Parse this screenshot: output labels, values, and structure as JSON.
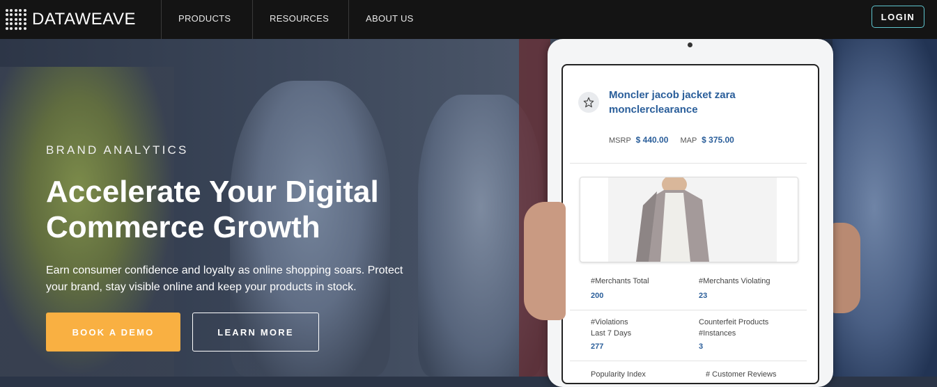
{
  "brand": {
    "name": "DATAWEAVE"
  },
  "nav": {
    "items": [
      {
        "label": "PRODUCTS"
      },
      {
        "label": "RESOURCES"
      },
      {
        "label": "ABOUT US"
      }
    ],
    "login_label": "LOGIN"
  },
  "hero": {
    "eyebrow": "BRAND ANALYTICS",
    "headline_line1": "Accelerate Your Digital",
    "headline_line2": "Commerce Growth",
    "subtext_line1": "Earn consumer confidence and loyalty as online shopping soars. Protect",
    "subtext_line2": "your brand, stay visible online and keep your products in stock.",
    "primary_cta": "BOOK A DEMO",
    "secondary_cta": "LEARN MORE"
  },
  "product_card": {
    "title_line1": "Moncler jacob jacket zara",
    "title_line2": "monclerclearance",
    "msrp_label": "MSRP",
    "msrp_value": "$ 440.00",
    "map_label": "MAP",
    "map_value": "$ 375.00",
    "stats": [
      {
        "label": "#Merchants Total",
        "value": "200"
      },
      {
        "label": "#Merchants Violating",
        "value": "23"
      },
      {
        "label_line1": "#Violations",
        "label_line2": "Last 7 Days",
        "value": "277"
      },
      {
        "label_line1": "Counterfeit Products",
        "label_line2": "#Instances",
        "value": "3"
      },
      {
        "label": "Popularity Index"
      },
      {
        "label": "# Customer Reviews"
      }
    ]
  },
  "colors": {
    "nav_bg": "#141414",
    "accent_orange": "#f9b042",
    "login_border": "#5fc6cf",
    "product_blue": "#2a5e9a"
  },
  "icons": {
    "star": "star-outline-icon",
    "logo": "dot-grid-logo-icon"
  }
}
